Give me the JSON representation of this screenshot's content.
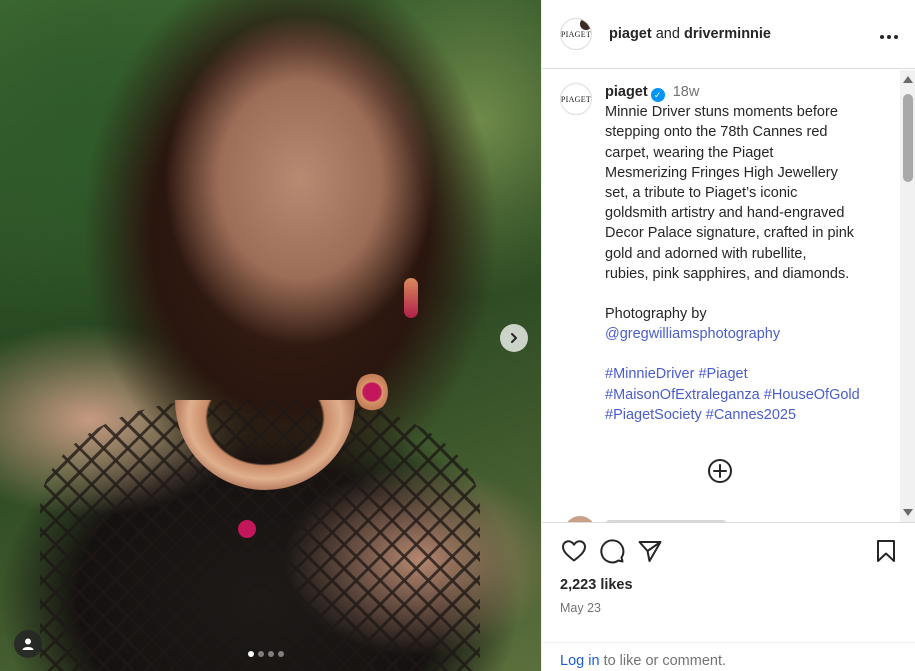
{
  "post": {
    "header": {
      "author": "piaget",
      "joiner": "and",
      "collaborator": "driverminnie",
      "avatar_text": "PIAGET",
      "more_icon": "more-options-icon"
    },
    "caption": {
      "username": "piaget",
      "verified_icon": "verified-badge-icon",
      "age": "18w",
      "lines": [
        "Minnie Driver stuns moments before",
        "stepping onto the 78th Cannes red",
        "carpet, wearing the Piaget",
        "Mesmerizing Fringes High Jewellery",
        "set, a tribute to Piaget’s iconic",
        "goldsmith artistry and hand-engraved",
        "Decor Palace signature, crafted in pink",
        "gold and adorned with rubellite,",
        "rubies, pink sapphires, and diamonds."
      ],
      "photo_credit": "Photography by",
      "photographer": "@gregwilliamsphotography",
      "hashtags_line1": "#MinnieDriver #Piaget",
      "hashtags_line2": "#MaisonOfExtraleganza #HouseOfGold",
      "hashtags_line3": "#PiagetSociety #Cannes2025"
    },
    "load_more_icon": "plus-circle-icon",
    "likes": "2,223 likes",
    "date": "May 23",
    "login": {
      "link": "Log in",
      "rest": " to like or comment."
    },
    "carousel": {
      "slide_count": 4,
      "active_index": 0,
      "next_icon": "chevron-right-icon",
      "tag_icon": "user-tag-icon"
    },
    "colors": {
      "link_blue": "#4a5dc9",
      "verified_blue": "#0095f6",
      "muted_text": "#737373"
    }
  }
}
